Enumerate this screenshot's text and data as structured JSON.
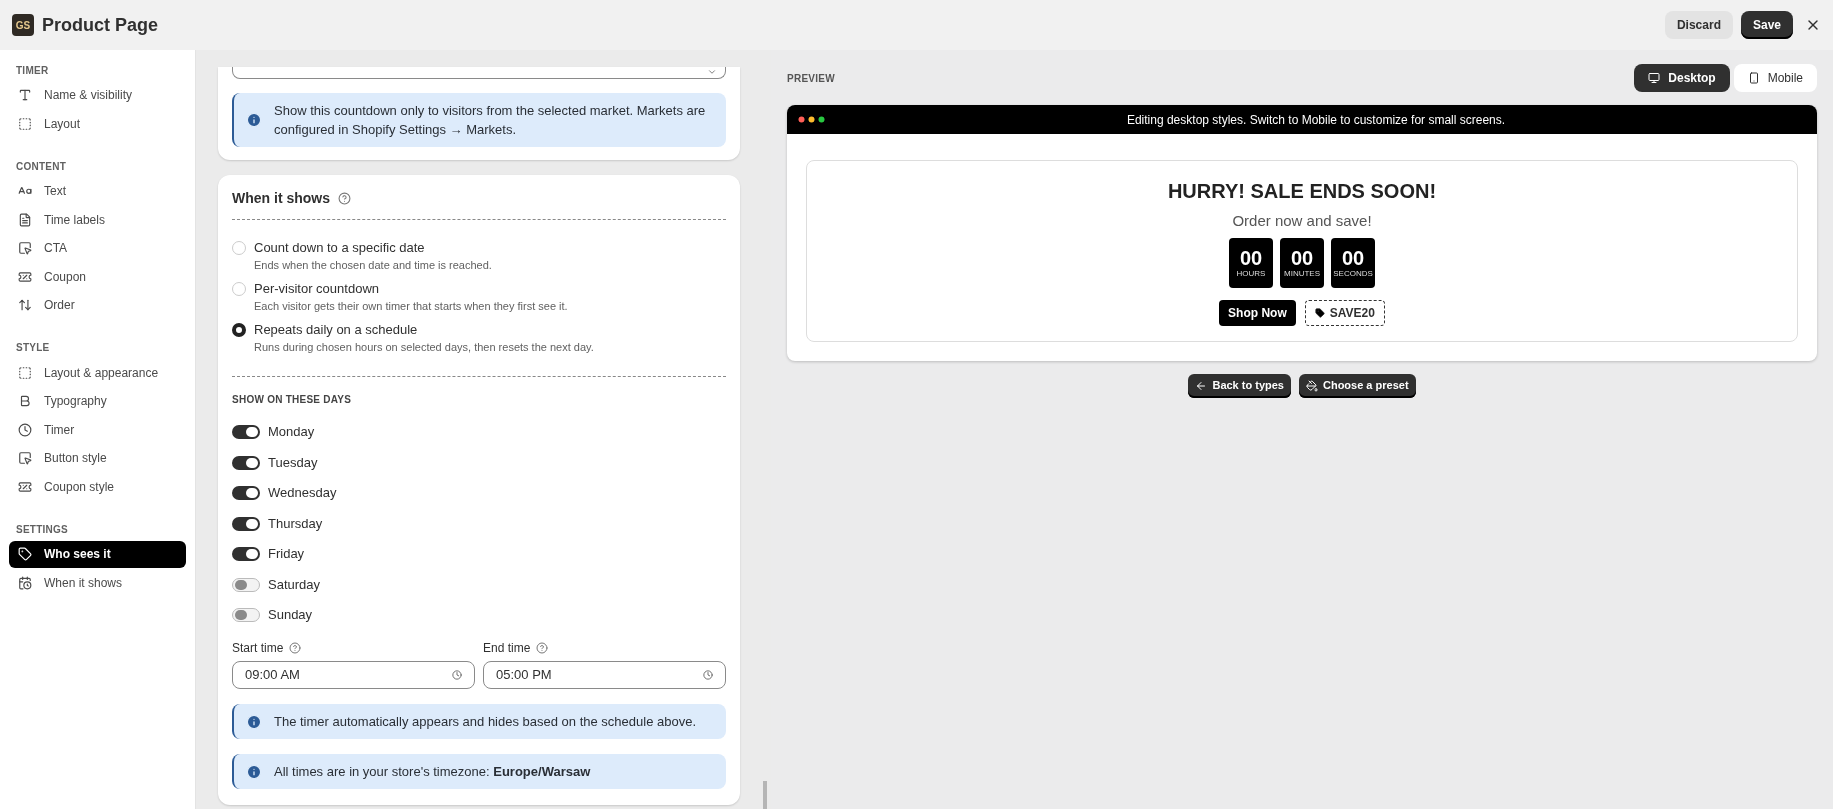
{
  "window": {
    "title": "Product Page",
    "logo": "GS",
    "buttons": [
      {
        "label": "Discard",
        "kind": "secondary"
      },
      {
        "label": "Save",
        "kind": "primary"
      }
    ]
  },
  "sidebar": {
    "sections": [
      {
        "title": "TIMER",
        "items": [
          {
            "label": "Name & visibility",
            "selected": false
          },
          {
            "label": "Layout",
            "selected": false
          }
        ]
      },
      {
        "title": "CONTENT",
        "items": [
          {
            "label": "Text",
            "selected": false
          },
          {
            "label": "Time labels",
            "selected": false
          },
          {
            "label": "CTA",
            "selected": false
          },
          {
            "label": "Coupon",
            "selected": false
          },
          {
            "label": "Order",
            "selected": false
          }
        ]
      },
      {
        "title": "STYLE",
        "items": [
          {
            "label": "Layout & appearance",
            "selected": false
          },
          {
            "label": "Typography",
            "selected": false
          },
          {
            "label": "Timer",
            "selected": false
          },
          {
            "label": "Button style",
            "selected": false
          },
          {
            "label": "Coupon style",
            "selected": false
          }
        ]
      },
      {
        "title": "SETTINGS",
        "items": [
          {
            "label": "Who sees it",
            "selected": true
          },
          {
            "label": "When it shows",
            "selected": false
          }
        ]
      }
    ]
  },
  "market_card": {
    "info": "Show this countdown only to visitors from the selected market. Markets are configured in Shopify Settings → Markets."
  },
  "when_card": {
    "title": "When it shows",
    "options": [
      {
        "label": "Count down to a specific date",
        "description": "Ends when the chosen date and time is reached.",
        "selected": false
      },
      {
        "label": "Per-visitor countdown",
        "description": "Each visitor gets their own timer that starts when they first see it.",
        "selected": false
      },
      {
        "label": "Repeats daily on a schedule",
        "description": "Runs during chosen hours on selected days, then resets the next day.",
        "selected": true
      }
    ],
    "days_heading": "SHOW ON THESE DAYS",
    "days": [
      {
        "label": "Monday",
        "on": true
      },
      {
        "label": "Tuesday",
        "on": true
      },
      {
        "label": "Wednesday",
        "on": true
      },
      {
        "label": "Thursday",
        "on": true
      },
      {
        "label": "Friday",
        "on": true
      },
      {
        "label": "Saturday",
        "on": false
      },
      {
        "label": "Sunday",
        "on": false
      }
    ],
    "times": [
      {
        "label": "Start time",
        "value": "09:00 AM"
      },
      {
        "label": "End time",
        "value": "05:00 PM"
      }
    ],
    "notes": [
      "The timer automatically appears and hides based on the schedule above.",
      "All times are in your store's timezone: **Europe/Warsaw**"
    ]
  },
  "preview": {
    "label": "PREVIEW",
    "devices": [
      {
        "label": "Desktop",
        "kind": "desktop",
        "selected": true
      },
      {
        "label": "Mobile",
        "kind": "mobile",
        "selected": false
      }
    ],
    "banner": "Editing desktop styles. Switch to Mobile to customize for small screens.",
    "heading": "HURRY! SALE ENDS SOON!",
    "subheading": "Order now and save!",
    "units": [
      {
        "value": "00",
        "label": "HOURS"
      },
      {
        "value": "00",
        "label": "MINUTES"
      },
      {
        "value": "00",
        "label": "SECONDS"
      }
    ],
    "cta": "Shop Now",
    "coupon": "SAVE20",
    "actions": [
      {
        "label": "Back to types",
        "kind": "back"
      },
      {
        "label": "Choose a preset",
        "kind": "preset"
      }
    ]
  }
}
